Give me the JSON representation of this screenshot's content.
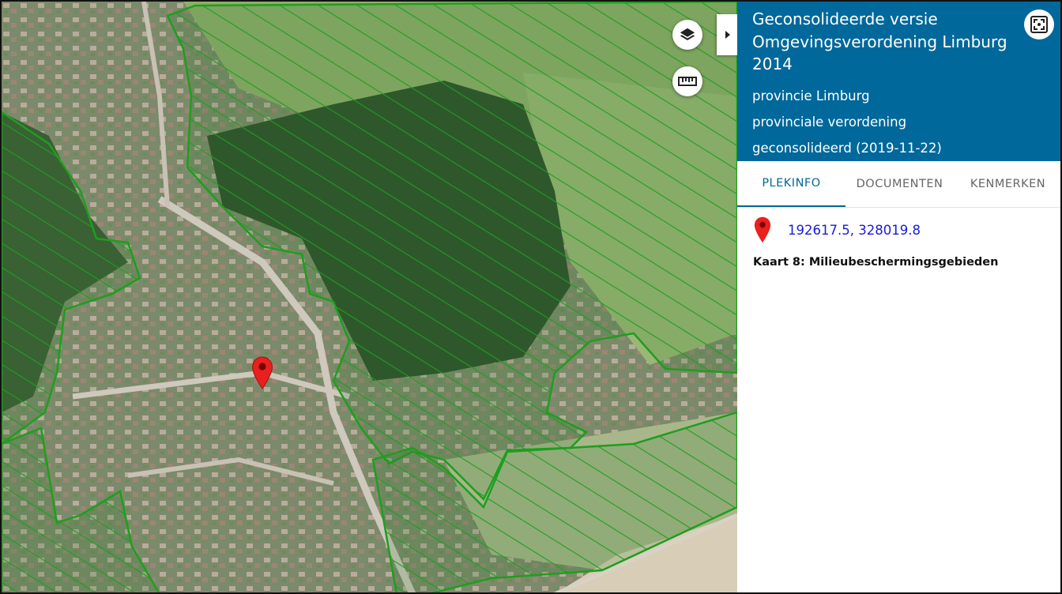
{
  "map": {
    "layers_icon": "layers-icon",
    "measure_icon": "ruler-icon",
    "collapse_icon": "caret-right-icon",
    "marker_icon": "map-marker-icon",
    "colors": {
      "hatch": "#1e9e1e",
      "marker": "#e8201e"
    }
  },
  "panel": {
    "title": "Geconsolideerde versie Omgevingsverordening Limburg 2014",
    "authority": "provincie Limburg",
    "doc_type": "provinciale verordening",
    "status": "geconsolideerd (2019-11-22)",
    "expand_icon": "fullscreen-icon",
    "header_color": "#01689b"
  },
  "tabs": [
    {
      "label": "PLEKINFO",
      "active": true
    },
    {
      "label": "DOCUMENTEN",
      "active": false
    },
    {
      "label": "KENMERKEN",
      "active": false
    }
  ],
  "plekinfo": {
    "coordinates": "192617.5, 328019.8",
    "layer_name": "Kaart 8: Milieubeschermingsgebieden"
  }
}
